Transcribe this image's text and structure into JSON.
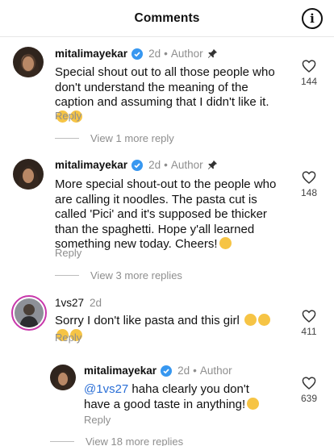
{
  "header": {
    "title": "Comments",
    "info_icon": "info-icon"
  },
  "comments": [
    {
      "username": "mitalimayekar",
      "time": "2d",
      "author_tag": "Author",
      "text": "Special shout out to all those people who don't understand the meaning of the caption and assuming that I didn't like it.",
      "emojis": [
        "yawning-face",
        "slightly-smiling-face"
      ],
      "reply": "Reply",
      "likes": "144",
      "view_more": "View 1 more reply"
    },
    {
      "username": "mitalimayekar",
      "time": "2d",
      "author_tag": "Author",
      "text": "More special shout-out to the people who are calling it noodles. The pasta cut is called 'Pici' and it's supposed be thicker than the spaghetti. Hope y'all learned something new today. Cheers!",
      "emojis": [
        "partying-face"
      ],
      "reply": "Reply",
      "likes": "148",
      "view_more": "View 3 more replies"
    },
    {
      "username": "1vs27",
      "time": "2d",
      "text": "Sorry I don't like pasta and this girl",
      "emojis": [
        "laughing-face",
        "laughing-face",
        "laughing-face",
        "laughing-face"
      ],
      "reply": "Reply",
      "likes": "411"
    },
    {
      "username": "mitalimayekar",
      "time": "2d",
      "author_tag": "Author",
      "mention": "@1vs27",
      "text": " haha clearly you don't have a good taste in anything!",
      "emojis": [
        "grinning-face"
      ],
      "reply": "Reply",
      "likes": "639",
      "view_more": "View 18 more replies"
    }
  ],
  "colors": {
    "verified": "#3797f0",
    "mention": "#2b6fd6",
    "muted": "#8e8e8e",
    "story_ring": "#c837ab"
  }
}
